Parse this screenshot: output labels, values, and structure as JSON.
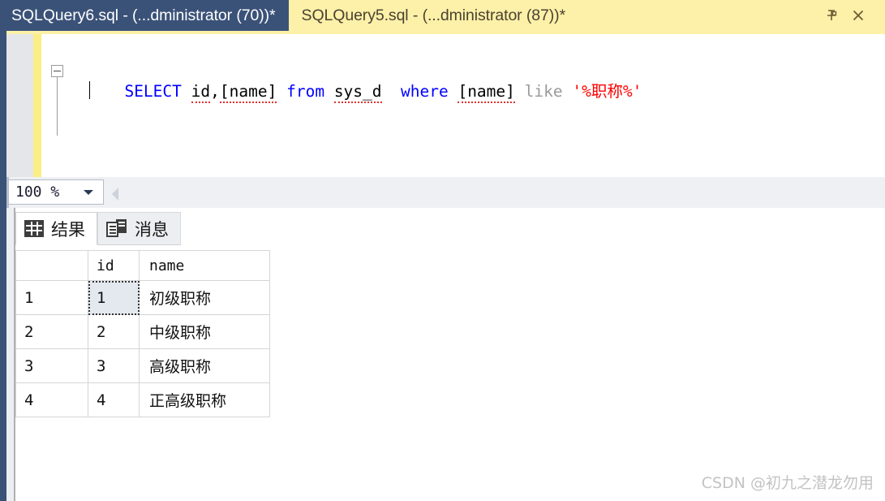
{
  "tabs": [
    {
      "label": "SQLQuery6.sql - (...dministrator (70))*",
      "active": false
    },
    {
      "label": "SQLQuery5.sql - (...dministrator (87))*",
      "active": true
    }
  ],
  "tab_buttons": {
    "pin": "pin-icon",
    "close": "close-icon"
  },
  "editor": {
    "outline_toggle": "collapse-minus",
    "code": {
      "full_text": "SELECT id,[name] from sys_d  where [name] like '%职称%'",
      "tokens": [
        {
          "text": "SELECT",
          "kind": "keyword"
        },
        {
          "text": " ",
          "kind": "plain"
        },
        {
          "text": "id",
          "kind": "identifier-squiggly"
        },
        {
          "text": ",",
          "kind": "plain"
        },
        {
          "text": "[name]",
          "kind": "identifier-squiggly"
        },
        {
          "text": " ",
          "kind": "plain"
        },
        {
          "text": "from",
          "kind": "keyword"
        },
        {
          "text": " ",
          "kind": "plain"
        },
        {
          "text": "sys_d",
          "kind": "identifier-squiggly"
        },
        {
          "text": "  ",
          "kind": "plain"
        },
        {
          "text": "where",
          "kind": "keyword"
        },
        {
          "text": " ",
          "kind": "plain"
        },
        {
          "text": "[name]",
          "kind": "identifier-squiggly"
        },
        {
          "text": " ",
          "kind": "plain"
        },
        {
          "text": "like",
          "kind": "keyword-gray"
        },
        {
          "text": " ",
          "kind": "plain"
        },
        {
          "text": "'%职称%'",
          "kind": "string"
        }
      ]
    },
    "colors": {
      "keyword": "#0000ff",
      "keyword_gray": "#9a9a9a",
      "string": "#ff0000",
      "identifier": "#000000",
      "squiggly": "#e03030",
      "change_bar": "#fcee86"
    }
  },
  "zoom_bar": {
    "value": "100 %",
    "dropdown_icon": "chevron-down-icon",
    "splitter_icon": "splitter-left-arrow"
  },
  "result_tabs": [
    {
      "label": "结果",
      "icon": "grid-icon",
      "selected": true
    },
    {
      "label": "消息",
      "icon": "message-icon",
      "selected": false
    }
  ],
  "grid": {
    "columns": [
      "",
      "id",
      "name"
    ],
    "rows": [
      {
        "rownum": "1",
        "id": "1",
        "name": "初级职称"
      },
      {
        "rownum": "2",
        "id": "2",
        "name": "中级职称"
      },
      {
        "rownum": "3",
        "id": "3",
        "name": "高级职称"
      },
      {
        "rownum": "4",
        "id": "4",
        "name": "正高级职称"
      }
    ],
    "selected_cell": {
      "row": 0,
      "column": "id"
    }
  },
  "watermark": "CSDN @初九之潜龙勿用",
  "theme": {
    "tabbar_bg": "#3b5278",
    "active_tab_bg": "#fdf0a8",
    "panel_bg": "#eceef1"
  }
}
